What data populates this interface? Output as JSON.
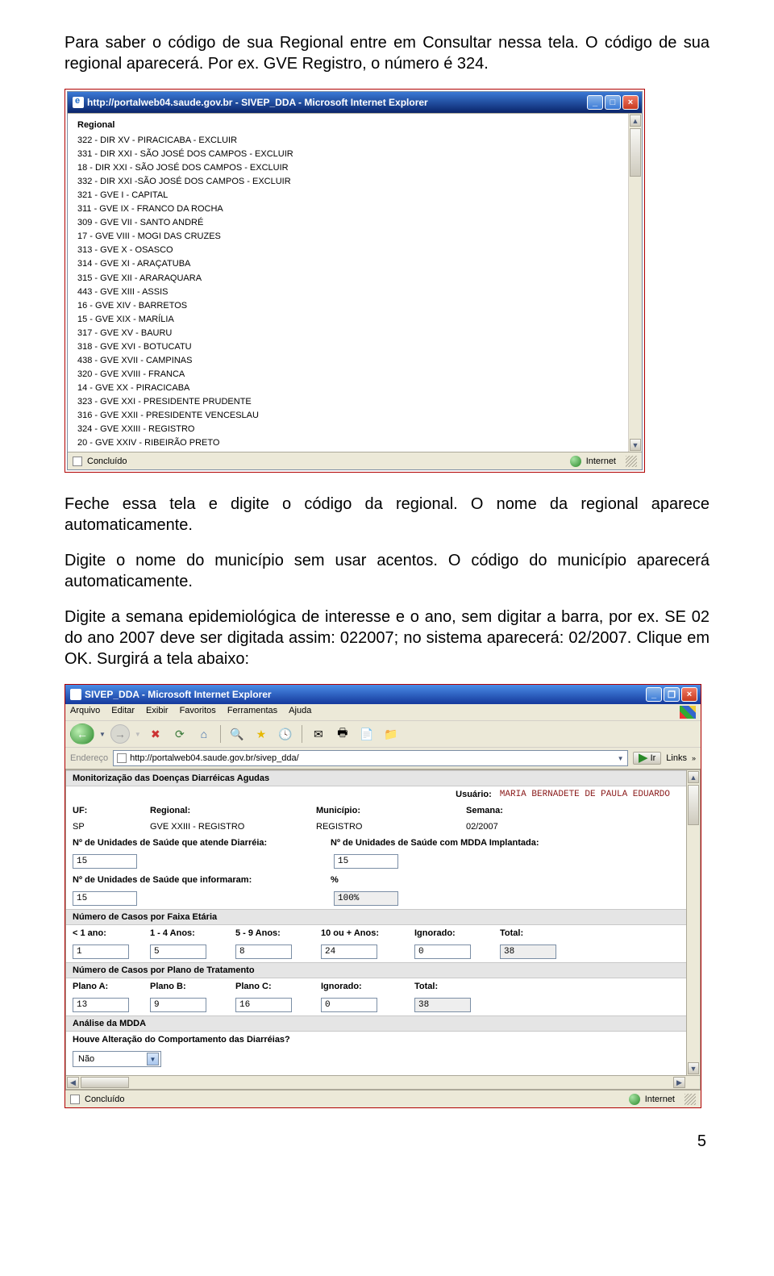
{
  "doc": {
    "para1": "Para saber o código de sua Regional entre em Consultar nessa tela. O código de sua regional aparecerá. Por ex. GVE Registro, o número é 324.",
    "para2": "Feche essa tela e digite o código da regional. O nome da regional aparece automaticamente.",
    "para3": "Digite o nome do município sem usar acentos. O código do município aparecerá automaticamente.",
    "para4": "Digite a semana epidemiológica de interesse e o ano, sem digitar a barra, por ex. SE 02 do ano 2007 deve ser digitada assim: 022007; no sistema aparecerá: 02/2007. Clique em OK. Surgirá a tela abaixo:",
    "page_number": "5"
  },
  "shot1": {
    "title": "http://portalweb04.saude.gov.br - SIVEP_DDA - Microsoft Internet Explorer",
    "heading": "Regional",
    "rows": [
      "322 - DIR XV - PIRACICABA - EXCLUIR",
      "331 - DIR XXI - SÃO JOSÉ DOS CAMPOS - EXCLUIR",
      "18 - DIR XXI - SÃO JOSÉ DOS CAMPOS - EXCLUIR",
      "332 - DIR XXI -SÃO JOSÉ DOS CAMPOS - EXCLUIR",
      "321 - GVE I - CAPITAL",
      "311 - GVE IX - FRANCO DA ROCHA",
      "309 - GVE VII - SANTO ANDRÉ",
      "17 - GVE VIII - MOGI DAS CRUZES",
      "313 - GVE X - OSASCO",
      "314 - GVE XI - ARAÇATUBA",
      "315 - GVE XII - ARARAQUARA",
      "443 - GVE XIII - ASSIS",
      "16 - GVE XIV - BARRETOS",
      "15 - GVE XIX - MARÍLIA",
      "317 - GVE XV - BAURU",
      "318 - GVE XVI - BOTUCATU",
      "438 - GVE XVII - CAMPINAS",
      "320 - GVE XVIII - FRANCA",
      "14 - GVE XX - PIRACICABA",
      "323 - GVE XXI - PRESIDENTE PRUDENTE",
      "316 - GVE XXII - PRESIDENTE VENCESLAU",
      "324 - GVE XXIII - REGISTRO",
      "20 - GVE XXIV - RIBEIRÃO PRETO"
    ],
    "status_done": "Concluído",
    "status_zone": "Internet"
  },
  "shot2": {
    "title": "SIVEP_DDA - Microsoft Internet Explorer",
    "menus": [
      "Arquivo",
      "Editar",
      "Exibir",
      "Favoritos",
      "Ferramentas",
      "Ajuda"
    ],
    "addr_label": "Endereço",
    "url": "http://portalweb04.saude.gov.br/sivep_dda/",
    "go": "Ir",
    "links": "Links",
    "section_main": "Monitorização das Doenças Diarréicas Agudas",
    "user_label": "Usuário:",
    "user_value": "MARIA BERNADETE DE PAULA EDUARDO",
    "header1": {
      "uf": "UF:",
      "regional": "Regional:",
      "municipio": "Município:",
      "semana": "Semana:"
    },
    "row1": {
      "uf": "SP",
      "regional": "GVE XXIII - REGISTRO",
      "municipio": "REGISTRO",
      "semana": "02/2007"
    },
    "unid_label1": "Nº de Unidades de Saúde que atende Diarréia:",
    "unid_val1": "15",
    "unid_label2": "Nº de Unidades de Saúde com MDDA Implantada:",
    "unid_val2": "15",
    "unid_label3": "Nº de Unidades de Saúde que informaram:",
    "unid_val3": "15",
    "pct_label": "%",
    "pct_val": "100%",
    "section_faixa": "Número de Casos por Faixa Etária",
    "faixa_head": {
      "c1": "< 1 ano:",
      "c2": "1 - 4 Anos:",
      "c3": "5 - 9 Anos:",
      "c4": "10 ou + Anos:",
      "c5": "Ignorado:",
      "c6": "Total:"
    },
    "faixa_row": {
      "c1": "1",
      "c2": "5",
      "c3": "8",
      "c4": "24",
      "c5": "0",
      "c6": "38"
    },
    "section_plano": "Número de Casos por Plano de Tratamento",
    "plano_head": {
      "c1": "Plano A:",
      "c2": "Plano B:",
      "c3": "Plano C:",
      "c4": "Ignorado:",
      "c5": "Total:"
    },
    "plano_row": {
      "c1": "13",
      "c2": "9",
      "c3": "16",
      "c4": "0",
      "c5": "38"
    },
    "section_analise": "Análise da MDDA",
    "analise_q": "Houve Alteração do Comportamento das Diarréias?",
    "analise_sel": "Não",
    "status_done": "Concluído",
    "status_zone": "Internet"
  }
}
